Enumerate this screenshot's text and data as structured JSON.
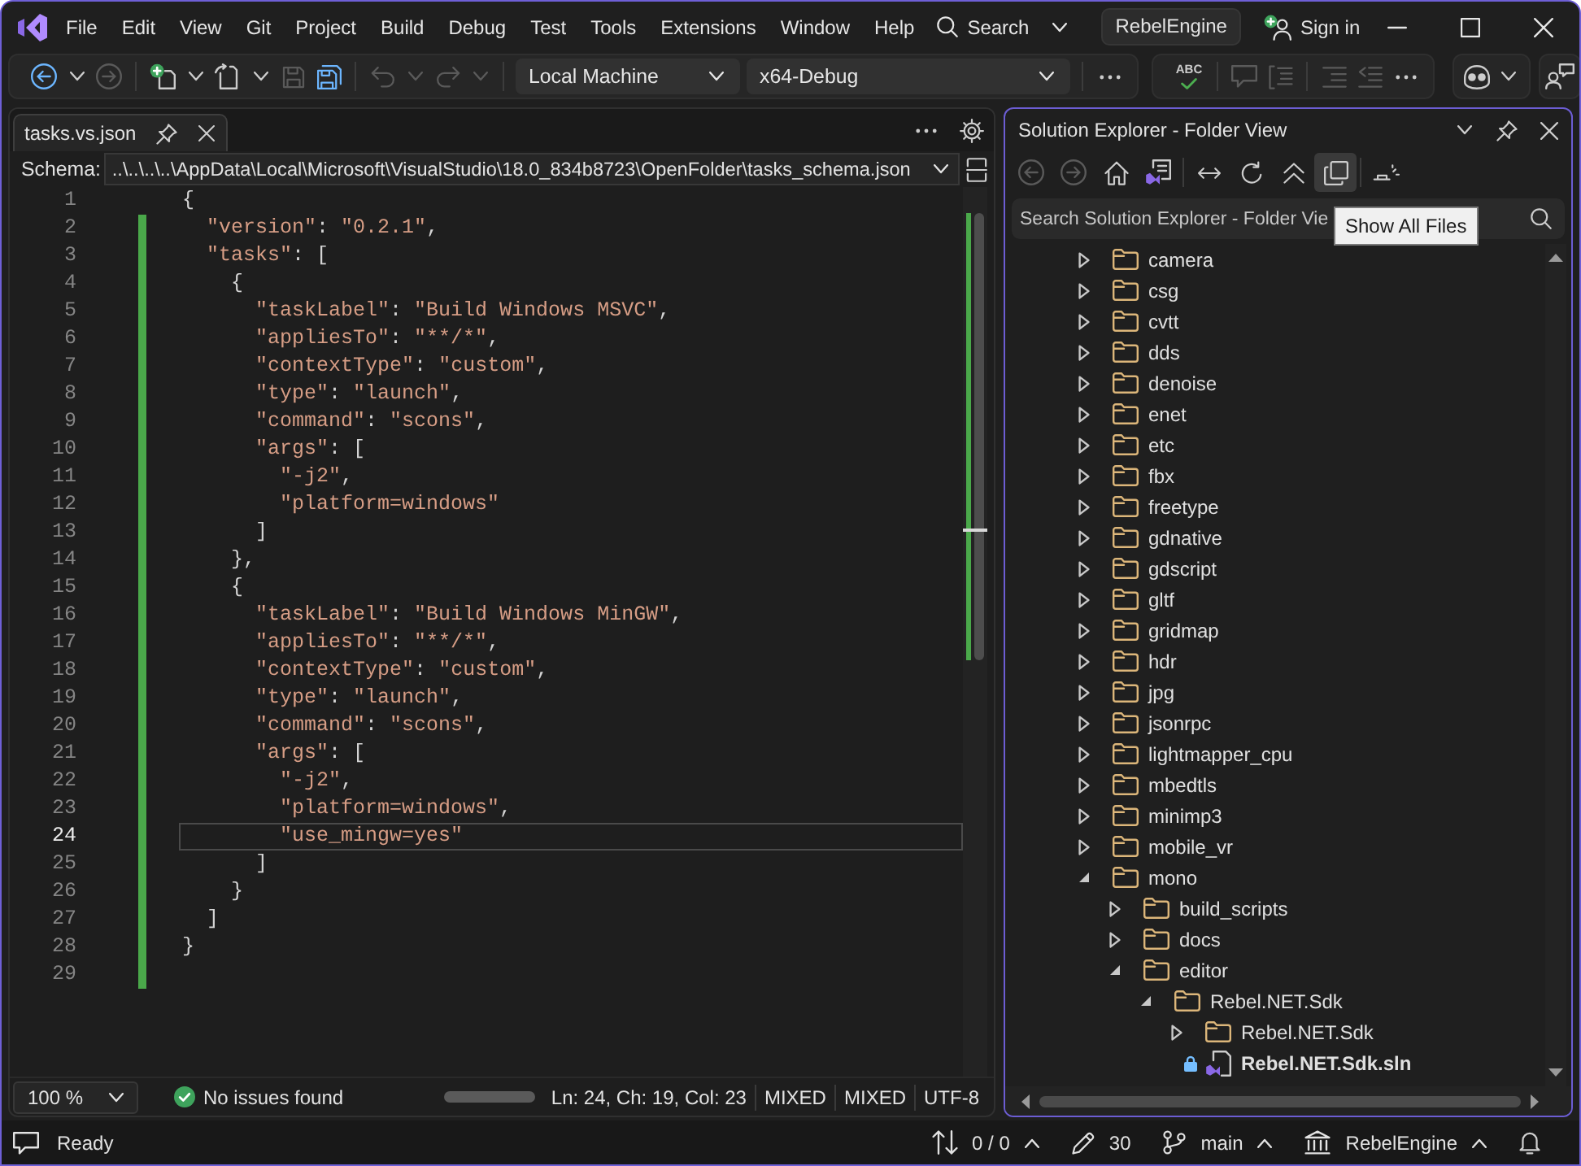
{
  "title_bar": {
    "menu": [
      "File",
      "Edit",
      "View",
      "Git",
      "Project",
      "Build",
      "Debug",
      "Test",
      "Tools",
      "Extensions",
      "Window",
      "Help"
    ],
    "search": "Search",
    "solution": "RebelEngine",
    "sign_in": "Sign in"
  },
  "toolbar": {
    "groups": [
      {
        "items": [
          {
            "kind": "back",
            "disabled": false
          },
          {
            "kind": "menu",
            "disabled": false
          },
          {
            "kind": "forward",
            "disabled": true
          },
          {
            "kind": "separator"
          },
          {
            "kind": "new",
            "disabled": false
          },
          {
            "kind": "menu",
            "disabled": false
          },
          {
            "kind": "open",
            "disabled": false
          },
          {
            "kind": "menu",
            "disabled": false
          },
          {
            "kind": "save",
            "disabled": true
          },
          {
            "kind": "save_all",
            "disabled": false
          },
          {
            "kind": "separator"
          },
          {
            "kind": "undo",
            "disabled": true
          },
          {
            "kind": "menu",
            "disabled": true
          },
          {
            "kind": "redo",
            "disabled": true
          },
          {
            "kind": "menu",
            "disabled": true
          },
          {
            "kind": "separator"
          },
          {
            "kind": "target",
            "value": "Local Machine"
          },
          {
            "kind": "configuration",
            "value": "x64-Debug"
          },
          {
            "kind": "separator"
          },
          {
            "kind": "more",
            "disabled": false
          }
        ]
      },
      {
        "items": [
          {
            "kind": "spelling",
            "label": "ABC",
            "disabled": false
          },
          {
            "kind": "separator"
          },
          {
            "kind": "comment",
            "disabled": true
          },
          {
            "kind": "uncomment",
            "disabled": true
          },
          {
            "kind": "separator"
          },
          {
            "kind": "indent",
            "disabled": true
          },
          {
            "kind": "outdent",
            "disabled": true
          },
          {
            "kind": "more",
            "disabled": false
          }
        ]
      },
      {
        "items": [
          {
            "kind": "assistant",
            "disabled": false
          },
          {
            "kind": "menu",
            "disabled": false
          }
        ]
      },
      {
        "items": [
          {
            "kind": "feedback",
            "disabled": false
          }
        ]
      }
    ]
  },
  "editor": {
    "tabs": [
      {
        "label": "tasks.vs.json",
        "selected": true
      }
    ],
    "schema": {
      "label": "Schema:",
      "value": "..\\..\\..\\..\\AppData\\Local\\Microsoft\\VisualStudio\\18.0_834b8723\\OpenFolder\\tasks_schema.json"
    },
    "lines": [
      {
        "number": "1",
        "text": "{",
        "changed": false,
        "current": false
      },
      {
        "number": "2",
        "text": "  \"version\": \"0.2.1\",",
        "changed": true,
        "current": false
      },
      {
        "number": "3",
        "text": "  \"tasks\": [",
        "changed": true,
        "current": false
      },
      {
        "number": "4",
        "text": "    {",
        "changed": true,
        "current": false
      },
      {
        "number": "5",
        "text": "      \"taskLabel\": \"Build Windows MSVC\",",
        "changed": true,
        "current": false
      },
      {
        "number": "6",
        "text": "      \"appliesTo\": \"**/*\",",
        "changed": true,
        "current": false
      },
      {
        "number": "7",
        "text": "      \"contextType\": \"custom\",",
        "changed": true,
        "current": false
      },
      {
        "number": "8",
        "text": "      \"type\": \"launch\",",
        "changed": true,
        "current": false
      },
      {
        "number": "9",
        "text": "      \"command\": \"scons\",",
        "changed": true,
        "current": false
      },
      {
        "number": "10",
        "text": "      \"args\": [",
        "changed": true,
        "current": false
      },
      {
        "number": "11",
        "text": "        \"-j2\",",
        "changed": true,
        "current": false
      },
      {
        "number": "12",
        "text": "        \"platform=windows\"",
        "changed": true,
        "current": false
      },
      {
        "number": "13",
        "text": "      ]",
        "changed": true,
        "current": false
      },
      {
        "number": "14",
        "text": "    },",
        "changed": true,
        "current": false
      },
      {
        "number": "15",
        "text": "    {",
        "changed": true,
        "current": false
      },
      {
        "number": "16",
        "text": "      \"taskLabel\": \"Build Windows MinGW\",",
        "changed": true,
        "current": false
      },
      {
        "number": "17",
        "text": "      \"appliesTo\": \"**/*\",",
        "changed": true,
        "current": false
      },
      {
        "number": "18",
        "text": "      \"contextType\": \"custom\",",
        "changed": true,
        "current": false
      },
      {
        "number": "19",
        "text": "      \"type\": \"launch\",",
        "changed": true,
        "current": false
      },
      {
        "number": "20",
        "text": "      \"command\": \"scons\",",
        "changed": true,
        "current": false
      },
      {
        "number": "21",
        "text": "      \"args\": [",
        "changed": true,
        "current": false
      },
      {
        "number": "22",
        "text": "        \"-j2\",",
        "changed": true,
        "current": false
      },
      {
        "number": "23",
        "text": "        \"platform=windows\",",
        "changed": true,
        "current": false
      },
      {
        "number": "24",
        "text": "        \"use_mingw=yes\"",
        "changed": true,
        "current": true
      },
      {
        "number": "25",
        "text": "      ]",
        "changed": true,
        "current": false
      },
      {
        "number": "26",
        "text": "    }",
        "changed": true,
        "current": false
      },
      {
        "number": "27",
        "text": "  ]",
        "changed": true,
        "current": false
      },
      {
        "number": "28",
        "text": "}",
        "changed": true,
        "current": false
      },
      {
        "number": "29",
        "changed": true,
        "current": false
      }
    ],
    "zoom": "100 %",
    "issues": "No issues found",
    "indicators": [
      "Ln: 24, Ch: 19, Col: 23",
      "MIXED",
      "MIXED",
      "UTF-8"
    ]
  },
  "solution_explorer": {
    "title": "Solution Explorer - Folder View",
    "toolbar": [
      {
        "kind": "back",
        "disabled": true,
        "hovered": false
      },
      {
        "kind": "forward",
        "disabled": true,
        "hovered": false
      },
      {
        "kind": "home",
        "disabled": false,
        "hovered": false
      },
      {
        "kind": "solutions",
        "disabled": false,
        "hovered": false
      },
      {
        "kind": "separator"
      },
      {
        "kind": "sync",
        "disabled": false,
        "hovered": false
      },
      {
        "kind": "refresh",
        "disabled": false,
        "hovered": false
      },
      {
        "kind": "collapse",
        "disabled": false,
        "hovered": false
      },
      {
        "kind": "show_all",
        "disabled": false,
        "hovered": true
      },
      {
        "kind": "separator"
      },
      {
        "kind": "properties",
        "disabled": false,
        "hovered": false
      }
    ],
    "search": {
      "placeholder": "Search Solution Explorer - Folder Vie"
    },
    "tooltip": "Show All Files",
    "tree": [
      {
        "label": "camera",
        "kind": "folder",
        "expanded": false
      },
      {
        "label": "csg",
        "kind": "folder",
        "expanded": false
      },
      {
        "label": "cvtt",
        "kind": "folder",
        "expanded": false
      },
      {
        "label": "dds",
        "kind": "folder",
        "expanded": false
      },
      {
        "label": "denoise",
        "kind": "folder",
        "expanded": false
      },
      {
        "label": "enet",
        "kind": "folder",
        "expanded": false
      },
      {
        "label": "etc",
        "kind": "folder",
        "expanded": false
      },
      {
        "label": "fbx",
        "kind": "folder",
        "expanded": false
      },
      {
        "label": "freetype",
        "kind": "folder",
        "expanded": false
      },
      {
        "label": "gdnative",
        "kind": "folder",
        "expanded": false
      },
      {
        "label": "gdscript",
        "kind": "folder",
        "expanded": false
      },
      {
        "label": "gltf",
        "kind": "folder",
        "expanded": false
      },
      {
        "label": "gridmap",
        "kind": "folder",
        "expanded": false
      },
      {
        "label": "hdr",
        "kind": "folder",
        "expanded": false
      },
      {
        "label": "jpg",
        "kind": "folder",
        "expanded": false
      },
      {
        "label": "jsonrpc",
        "kind": "folder",
        "expanded": false
      },
      {
        "label": "lightmapper_cpu",
        "kind": "folder",
        "expanded": false
      },
      {
        "label": "mbedtls",
        "kind": "folder",
        "expanded": false
      },
      {
        "label": "minimp3",
        "kind": "folder",
        "expanded": false
      },
      {
        "label": "mobile_vr",
        "kind": "folder",
        "expanded": false
      },
      {
        "label": "mono",
        "kind": "folder",
        "expanded": true,
        "children": [
          {
            "label": "build_scripts",
            "kind": "folder",
            "expanded": false
          },
          {
            "label": "docs",
            "kind": "folder",
            "expanded": false
          },
          {
            "label": "editor",
            "kind": "folder",
            "expanded": true,
            "children": [
              {
                "label": "Rebel.NET.Sdk",
                "kind": "folder",
                "expanded": true,
                "children": [
                  {
                    "label": "Rebel.NET.Sdk",
                    "kind": "folder",
                    "expanded": false
                  },
                  {
                    "label": "Rebel.NET.Sdk.sln",
                    "kind": "solution"
                  }
                ]
              }
            ]
          }
        ]
      }
    ]
  },
  "status_bar": {
    "message": "Ready",
    "changes": "0 / 0",
    "edits": "30",
    "branch": "main",
    "repository": "RebelEngine"
  }
}
